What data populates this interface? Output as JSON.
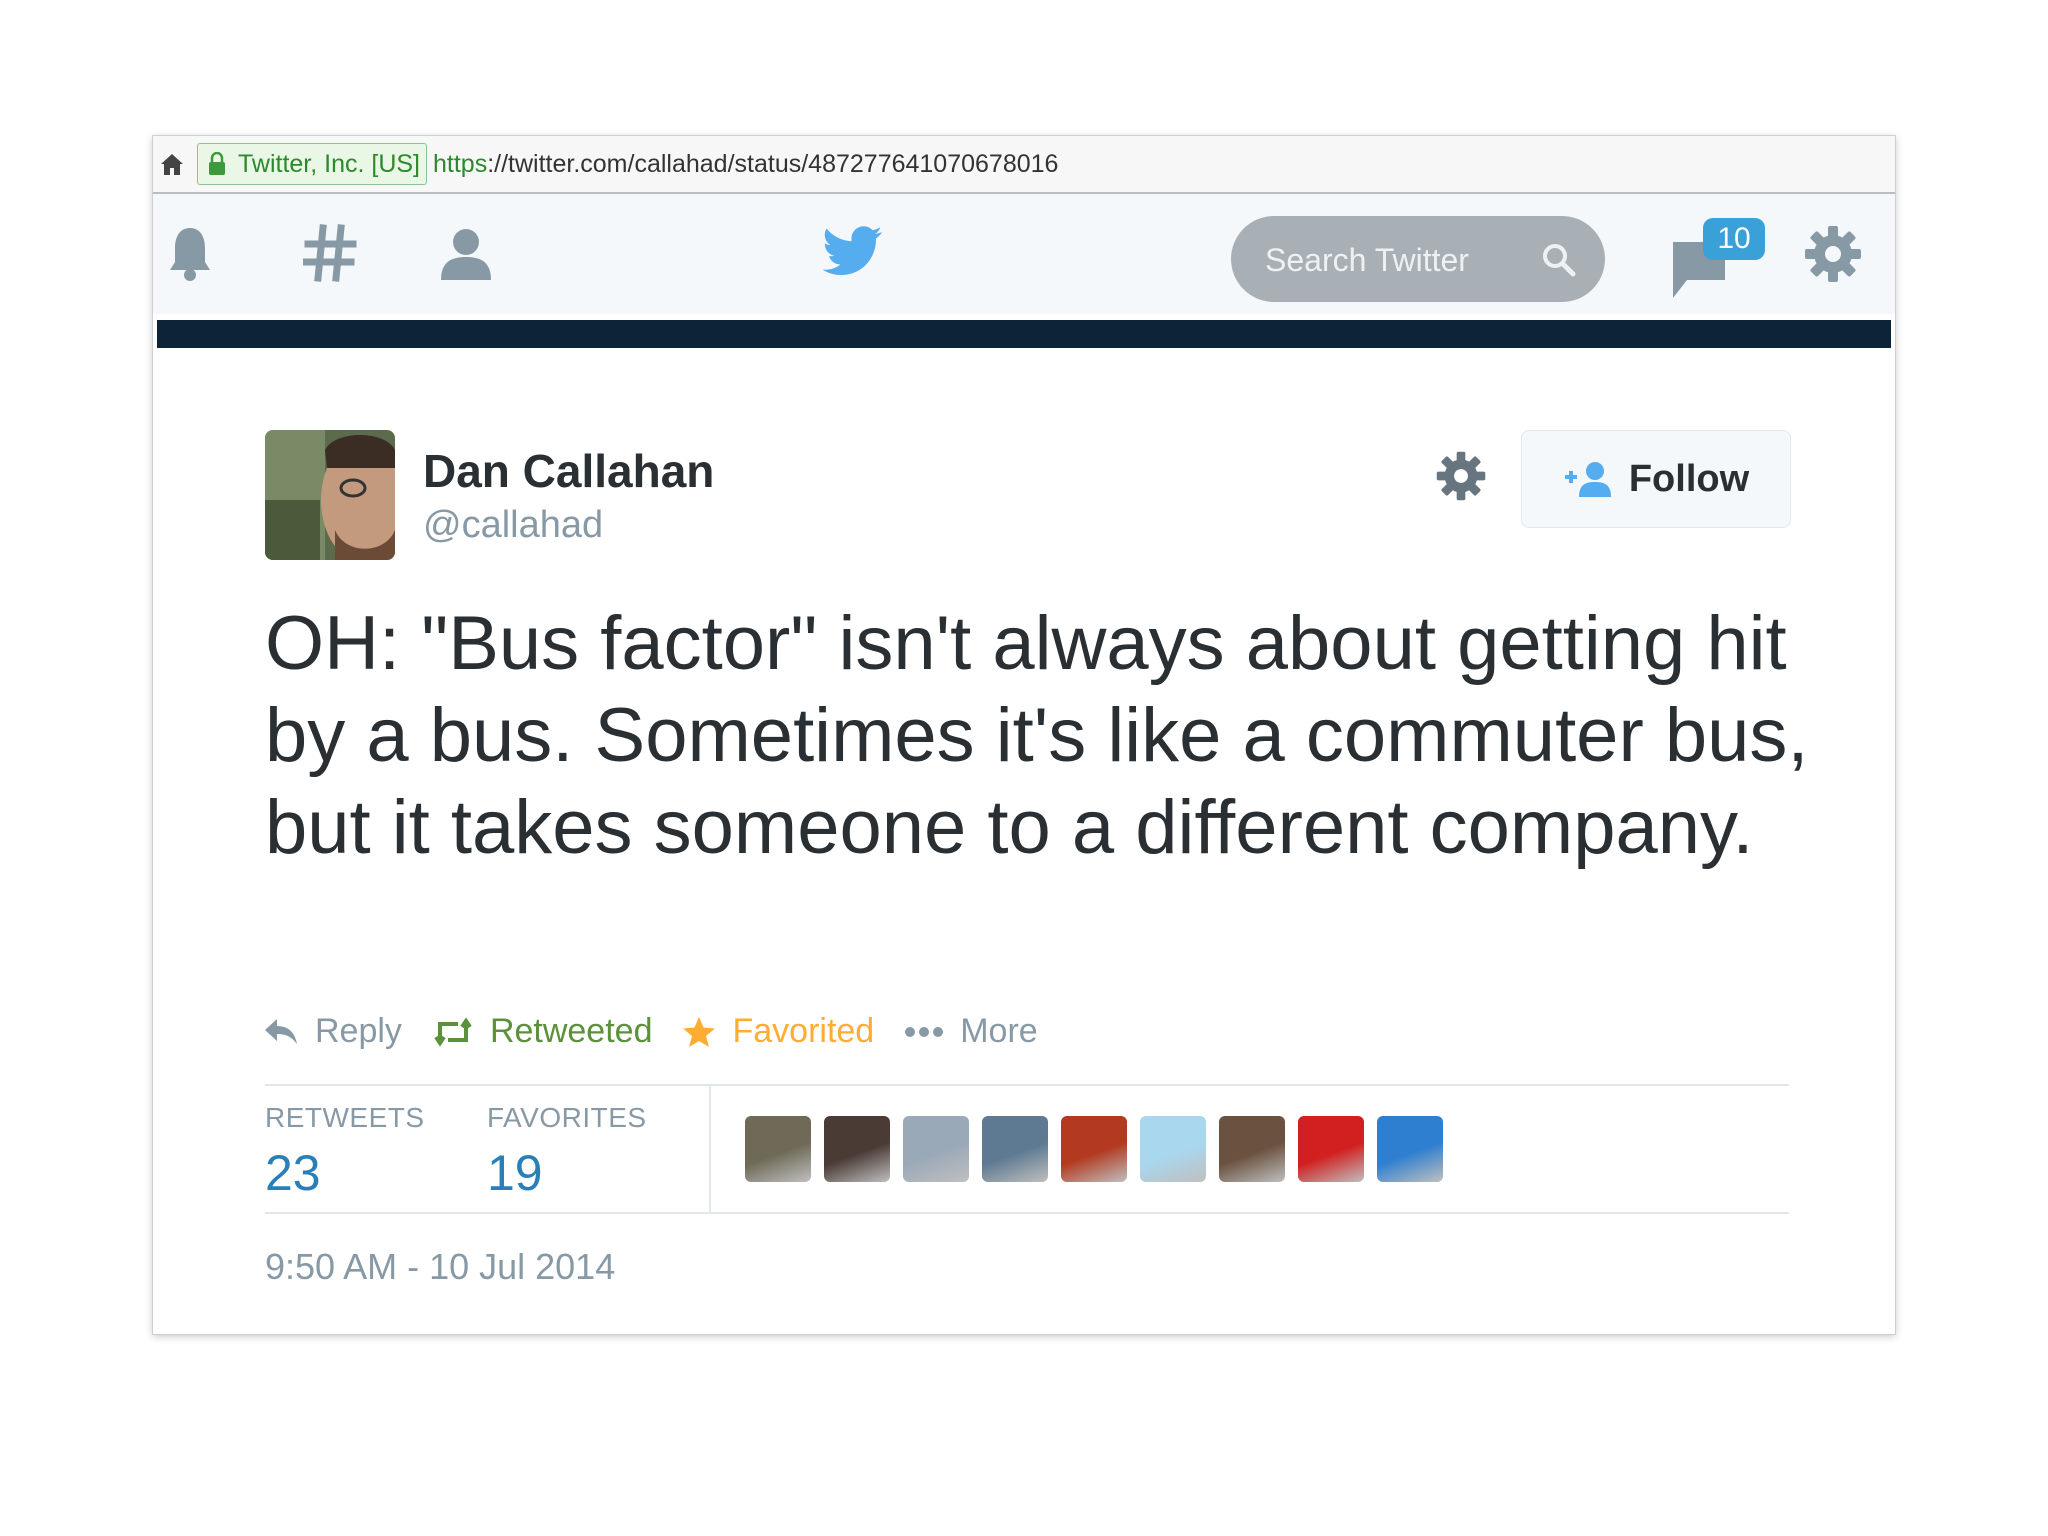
{
  "browser": {
    "certificate": "Twitter, Inc. [US]",
    "url_scheme": "https",
    "url_rest": "://twitter.com/callahad/status/487277641070678016"
  },
  "nav": {
    "search_placeholder": "Search Twitter",
    "messages_count": "10",
    "accent_color": "#55acee",
    "icons": [
      "bell-icon",
      "hashtag-icon",
      "person-icon",
      "twitter-bird-icon",
      "search-icon",
      "messages-icon",
      "gear-icon"
    ]
  },
  "tweet": {
    "author_name": "Dan Callahan",
    "author_handle": "@callahad",
    "follow_label": "Follow",
    "text": "OH: \"Bus factor\" isn't always about getting hit by a bus. Sometimes it's like a commuter bus, but it takes someone to a different company.",
    "actions": {
      "reply": "Reply",
      "retweet": "Retweeted",
      "favorite": "Favorited",
      "more": "More"
    },
    "stats": {
      "retweets_label": "RETWEETS",
      "retweets_value": "23",
      "favorites_label": "FAVORITES",
      "favorites_value": "19"
    },
    "favoriters": [
      {
        "color": "#6f6a57"
      },
      {
        "color": "#4a3b35"
      },
      {
        "color": "#9aa9b8"
      },
      {
        "color": "#5e7a92"
      },
      {
        "color": "#b33a20"
      },
      {
        "color": "#a9d7ee"
      },
      {
        "color": "#6b5240"
      },
      {
        "color": "#d21f1f"
      },
      {
        "color": "#2f7fd0"
      }
    ],
    "timestamp": "9:50 AM - 10 Jul 2014"
  }
}
